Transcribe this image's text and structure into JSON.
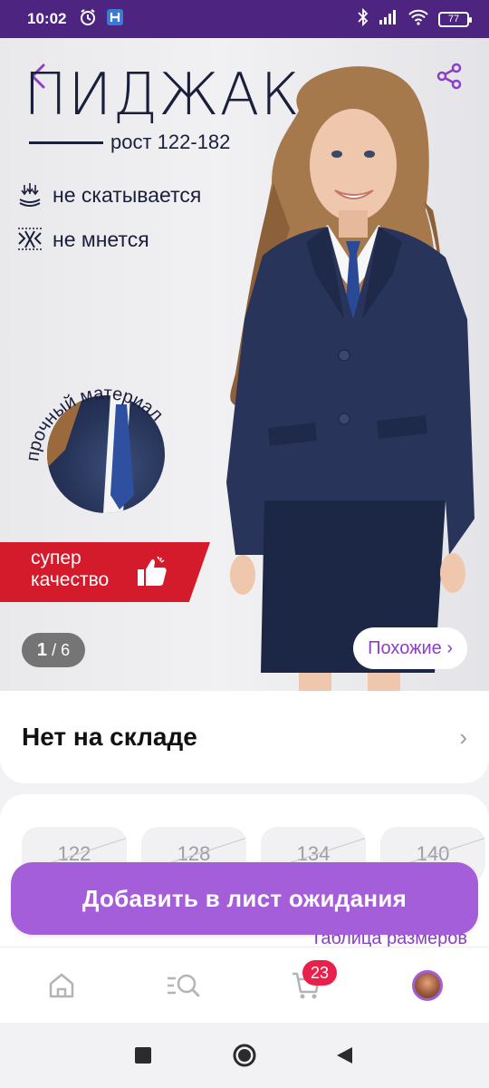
{
  "status_bar": {
    "time": "10:02",
    "battery": "77"
  },
  "product_image": {
    "title": "ПИДЖАК",
    "height_range": "рост 122-182",
    "features": [
      "не скатывается",
      "не мнется"
    ],
    "material_label": "прочный материал",
    "promo_line1": "супер",
    "promo_line2": "качество",
    "pager_current": "1",
    "pager_total": "/ 6",
    "similar_label": "Похожие ›"
  },
  "stock": {
    "label": "Нет на складе",
    "chevron": "›"
  },
  "sizes": {
    "options": [
      "122",
      "128",
      "134",
      "140"
    ],
    "size_table_link": "Таблица размеров"
  },
  "action": {
    "wait_list_label": "Добавить в лист ожидания"
  },
  "bottom_nav": {
    "cart_count": "23",
    "items": [
      "home-icon",
      "catalog-search-icon",
      "cart-icon",
      "profile-avatar"
    ]
  },
  "colors": {
    "status_bar": "#4d2480",
    "accent": "#a55ed9",
    "link": "#8b3fc7",
    "promo_red": "#d41b2c",
    "badge": "#e8204a"
  }
}
